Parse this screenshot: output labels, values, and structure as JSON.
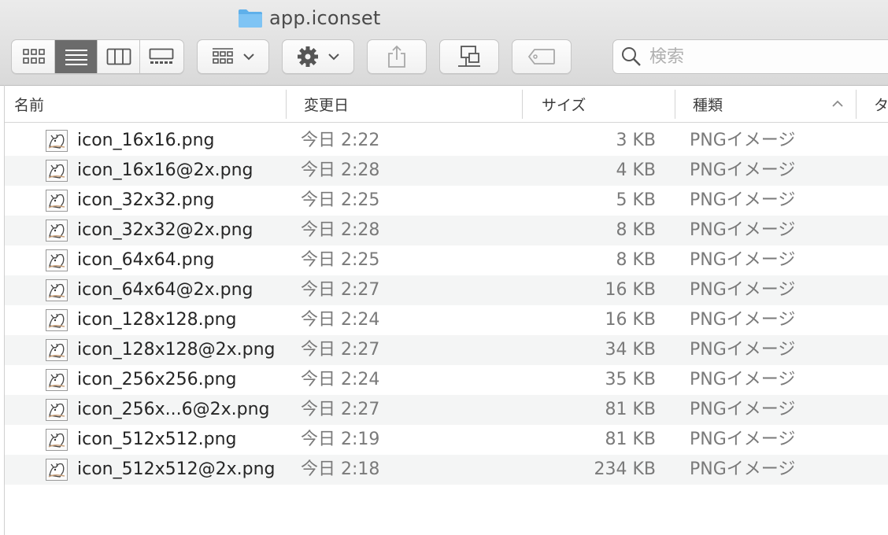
{
  "window": {
    "title": "app.iconset"
  },
  "toolbar": {
    "view_modes": [
      "icon-view",
      "list-view",
      "column-view",
      "gallery-view"
    ],
    "active_view": "list-view",
    "group_icon": "group-by-icon",
    "action_icon": "gear-icon",
    "share_icon": "share-icon",
    "connect_icon": "network-icon",
    "tag_icon": "tag-icon"
  },
  "search": {
    "placeholder": "検索"
  },
  "columns": {
    "name": "名前",
    "date": "変更日",
    "size": "サイズ",
    "kind": "種類",
    "extra": "タ"
  },
  "files": [
    {
      "name": "icon_16x16.png",
      "date": "今日 2:22",
      "size": "3 KB",
      "kind": "PNGイメージ"
    },
    {
      "name": "icon_16x16@2x.png",
      "date": "今日 2:28",
      "size": "4 KB",
      "kind": "PNGイメージ"
    },
    {
      "name": "icon_32x32.png",
      "date": "今日 2:25",
      "size": "5 KB",
      "kind": "PNGイメージ"
    },
    {
      "name": "icon_32x32@2x.png",
      "date": "今日 2:28",
      "size": "8 KB",
      "kind": "PNGイメージ"
    },
    {
      "name": "icon_64x64.png",
      "date": "今日 2:25",
      "size": "8 KB",
      "kind": "PNGイメージ"
    },
    {
      "name": "icon_64x64@2x.png",
      "date": "今日 2:27",
      "size": "16 KB",
      "kind": "PNGイメージ"
    },
    {
      "name": "icon_128x128.png",
      "date": "今日 2:24",
      "size": "16 KB",
      "kind": "PNGイメージ"
    },
    {
      "name": "icon_128x128@2x.png",
      "date": "今日 2:27",
      "size": "34 KB",
      "kind": "PNGイメージ"
    },
    {
      "name": "icon_256x256.png",
      "date": "今日 2:24",
      "size": "35 KB",
      "kind": "PNGイメージ"
    },
    {
      "name": "icon_256x...6@2x.png",
      "date": "今日 2:27",
      "size": "81 KB",
      "kind": "PNGイメージ"
    },
    {
      "name": "icon_512x512.png",
      "date": "今日 2:19",
      "size": "81 KB",
      "kind": "PNGイメージ"
    },
    {
      "name": "icon_512x512@2x.png",
      "date": "今日 2:18",
      "size": "234 KB",
      "kind": "PNGイメージ"
    }
  ]
}
